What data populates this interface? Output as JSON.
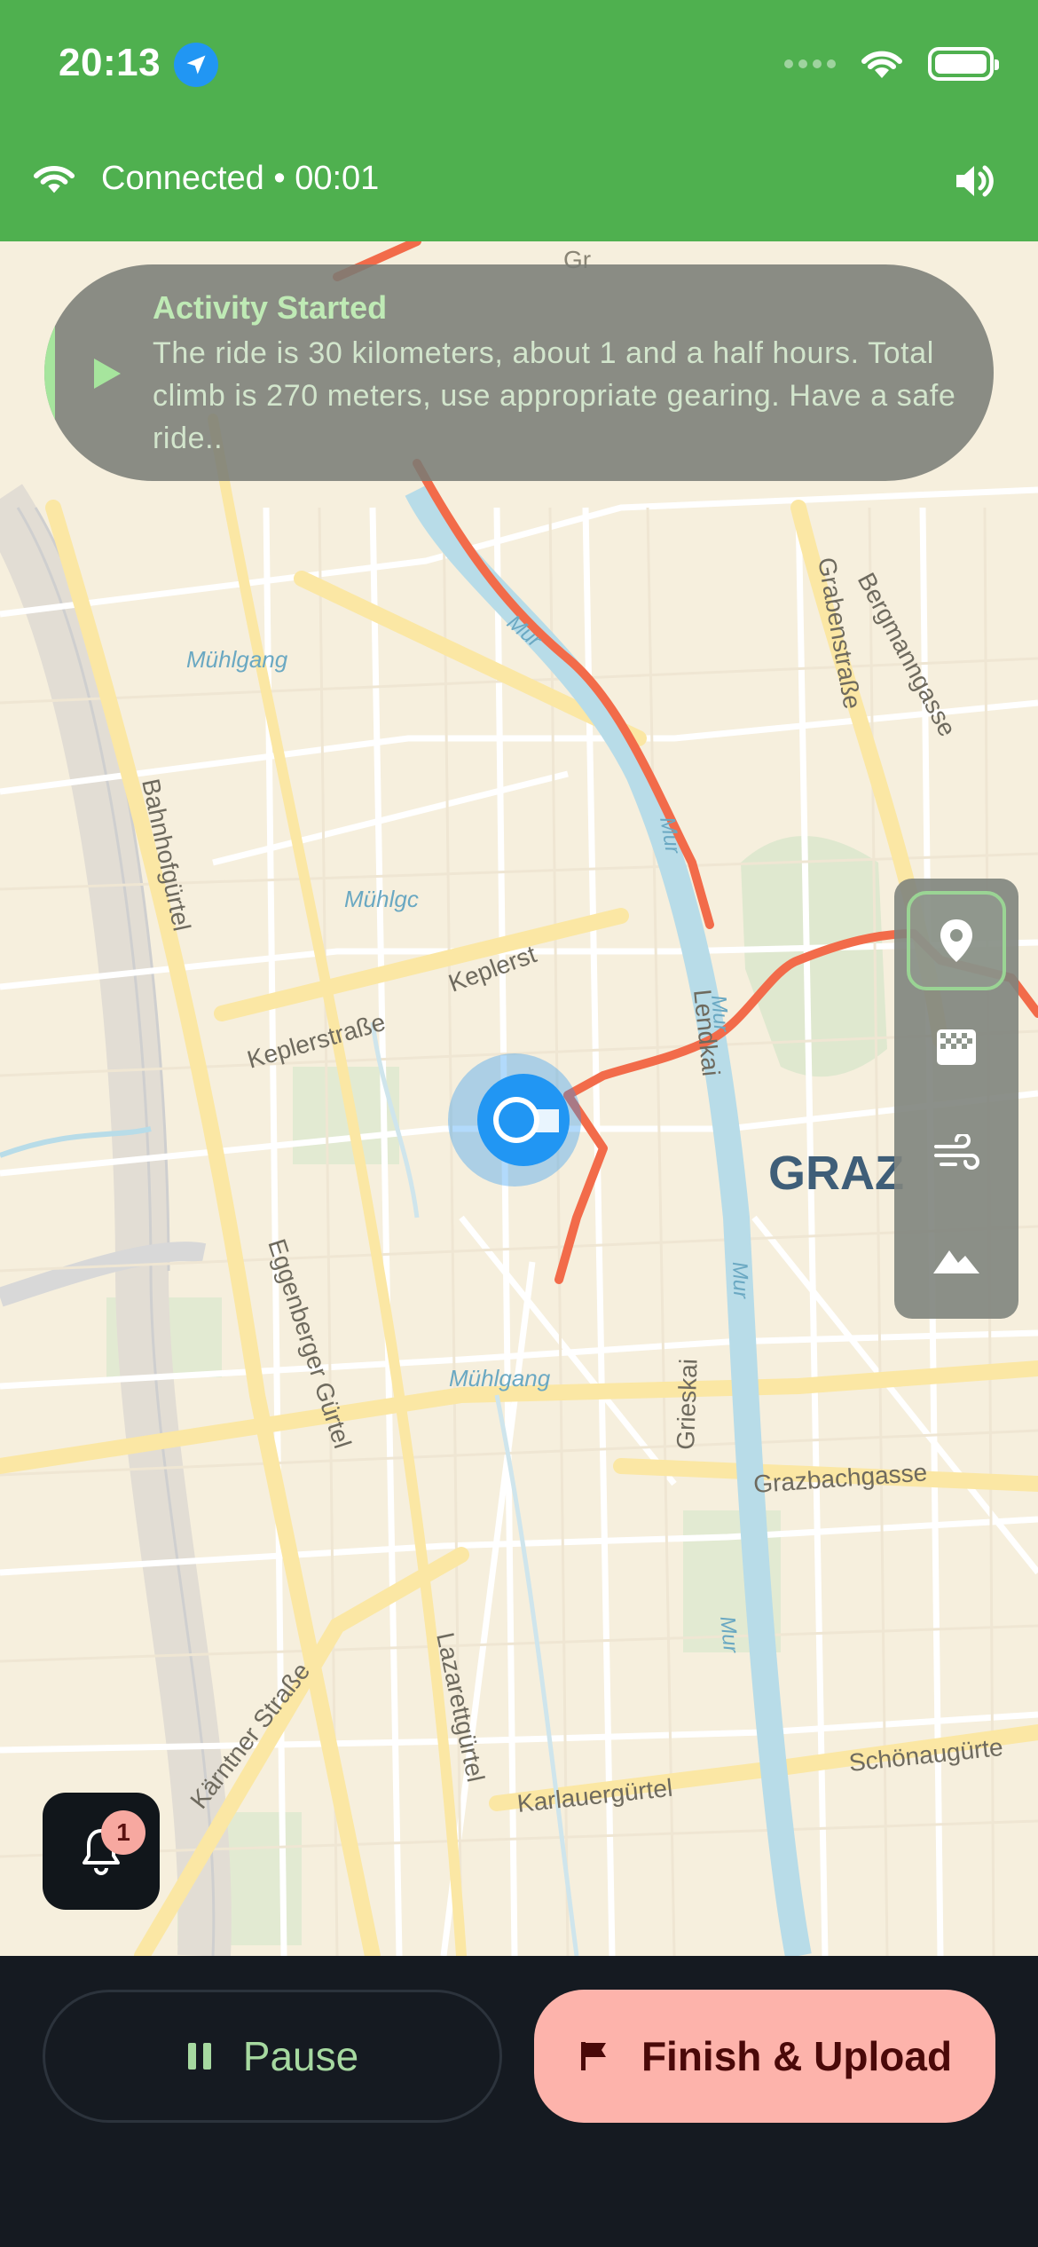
{
  "status_bar": {
    "time": "20:13"
  },
  "top_bar": {
    "connection_status": "Connected • 00:01"
  },
  "notification": {
    "title": "Activity Started",
    "body": "The ride is 30 kilometers, about 1 and a half hours. Total climb is 270 meters, use appropriate gearing. Have a safe ride.."
  },
  "map": {
    "labels": {
      "muhlgang_1": "Mühlgang",
      "muhlgang_2": "Mühlgc",
      "muhlgang_3": "Mühlgang",
      "bahnhofgurtel": "Bahnhofgürtel",
      "keplerstrasse_1": "Keplerstraße",
      "keplerstrasse_2": "Keplerst",
      "mur_1": "Mur",
      "mur_2": "Mur",
      "mur_3": "Mur",
      "mur_4": "Mur",
      "mur_5": "Mur",
      "lendkai": "Lendkai",
      "grabenstrasse": "Grabenstraße",
      "bergmanngasse": "Bergmanngasse",
      "graz": "GRAZ",
      "eggenberger_gurtel": "Eggenberger Gürtel",
      "grieskai": "Grieskai",
      "grazbachgasse": "Grazbachgasse",
      "karntner_strasse": "Kärntner Straße",
      "lazarettgurtel": "Lazarettgürtel",
      "karlauergurtel": "Karlauergürtel",
      "schonaugurtel": "Schönaugürte",
      "top_gr": "Gr"
    },
    "route_color": "#f26b4a",
    "river_color": "#b8dce8"
  },
  "layer_controls": {
    "items": [
      "map-pin-icon",
      "checkerboard-icon",
      "wind-icon",
      "mountain-icon"
    ],
    "active_index": 0
  },
  "notifications_bell": {
    "count": "1"
  },
  "bottom_bar": {
    "pause_label": "Pause",
    "finish_label": "Finish & Upload"
  },
  "colors": {
    "accent_green": "#4fb04f",
    "finish_button": "#fdb3ab",
    "location_blue": "#2196f3"
  }
}
